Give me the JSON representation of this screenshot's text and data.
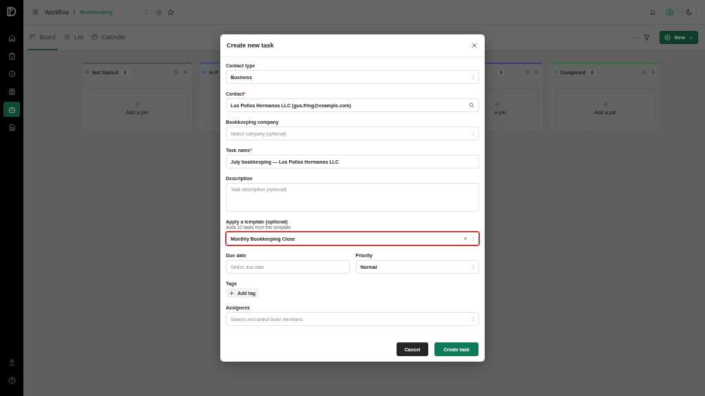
{
  "sidebar": {
    "items": [
      {
        "selected": false
      },
      {
        "selected": false
      },
      {
        "selected": false
      },
      {
        "selected": false
      },
      {
        "selected": true
      },
      {
        "selected": false
      }
    ],
    "bottom_items": [
      {
        "selected": false
      },
      {
        "selected": false
      }
    ]
  },
  "breadcrumb": {
    "parent": "Workflow",
    "separator": "/",
    "current": "Bookkeeping"
  },
  "tabs": [
    {
      "label": "Board",
      "selected": true
    },
    {
      "label": "List",
      "selected": false
    },
    {
      "label": "Calendar",
      "selected": false
    }
  ],
  "new_button": "New",
  "columns": [
    {
      "title": "Not Started",
      "count": "0",
      "color": "#4a4a4a",
      "add_label": "Add a job"
    },
    {
      "title": "In P",
      "color": "#2f4f7f"
    },
    {
      "count": "0",
      "color": "#3f3a78",
      "add_label": "a job"
    },
    {
      "title": "Completed",
      "count": "0",
      "color": "#2f6d45",
      "add_label": "Add a job"
    }
  ],
  "modal": {
    "title": "Create new task",
    "fields": [
      {
        "kind": "select",
        "label": "Contact type",
        "value": "Business",
        "focused": false
      },
      {
        "kind": "search",
        "label": "Contact",
        "required_mark": "*",
        "value": "Los Pollos Hermanos LLC (gus.fring@example.com)",
        "focused": false
      },
      {
        "kind": "select",
        "label": "Bookkeeping company",
        "placeholder": "Select company (optional)",
        "focused": false
      },
      {
        "kind": "text",
        "label": "Task name",
        "required_mark": "*",
        "value": "July bookkeeping — Los Pollos Hermanos LLC",
        "focused": false
      },
      {
        "kind": "textarea",
        "label": "Description",
        "placeholder": "Task description (optional)",
        "focused": false
      },
      {
        "kind": "select",
        "label": "Apply a template (optional)",
        "hint": "Adds 10 tasks from this template",
        "value": "Monthly Bookkeeping Close",
        "clearable": true,
        "focused": true
      },
      {
        "kind": "pair",
        "items": [
          {
            "kind": "text",
            "label": "Due date",
            "placeholder": "Select due date",
            "focused": false
          },
          {
            "kind": "select",
            "label": "Priority",
            "value": "Normal",
            "focused": false
          }
        ]
      },
      {
        "kind": "tags",
        "label": "Tags",
        "button": "Add tag"
      },
      {
        "kind": "select",
        "label": "Assignees",
        "placeholder": "Search and select team members",
        "focused": false
      }
    ],
    "buttons": [
      {
        "kind": "secondary",
        "label": "Cancel"
      },
      {
        "kind": "primary",
        "label": "Create task"
      }
    ]
  }
}
